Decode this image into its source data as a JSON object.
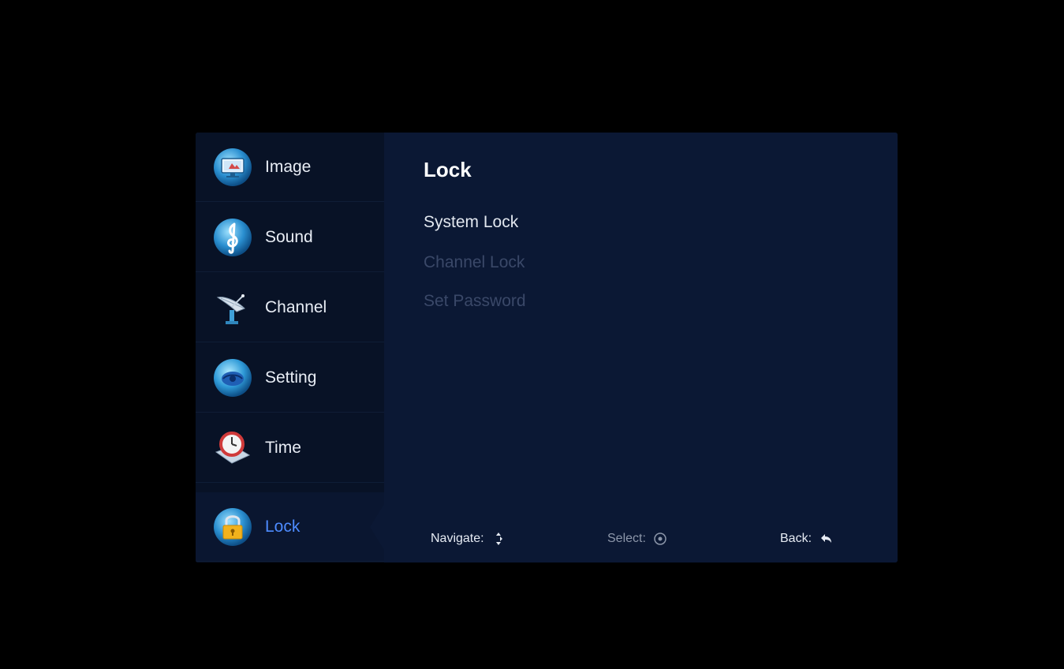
{
  "menu": {
    "items": [
      {
        "label": "Image",
        "icon": "monitor-icon"
      },
      {
        "label": "Sound",
        "icon": "treble-clef-icon"
      },
      {
        "label": "Channel",
        "icon": "satellite-dish-icon"
      },
      {
        "label": "Setting",
        "icon": "settings-globe-icon"
      },
      {
        "label": "Time",
        "icon": "clock-icon"
      },
      {
        "label": "Lock",
        "icon": "padlock-icon"
      }
    ],
    "selected": "Lock"
  },
  "content": {
    "title": "Lock",
    "options": [
      {
        "label": "System Lock",
        "state": "enabled"
      },
      {
        "label": "Channel Lock",
        "state": "disabled"
      },
      {
        "label": "Set Password",
        "state": "disabled"
      }
    ]
  },
  "footer": {
    "navigate": "Navigate:",
    "select": "Select:",
    "back": "Back:"
  },
  "colors": {
    "background": "#000000",
    "sidebar": "#081226",
    "content": "#0b1834",
    "selected_label": "#4d8bff",
    "disabled_text": "#3a4868"
  }
}
